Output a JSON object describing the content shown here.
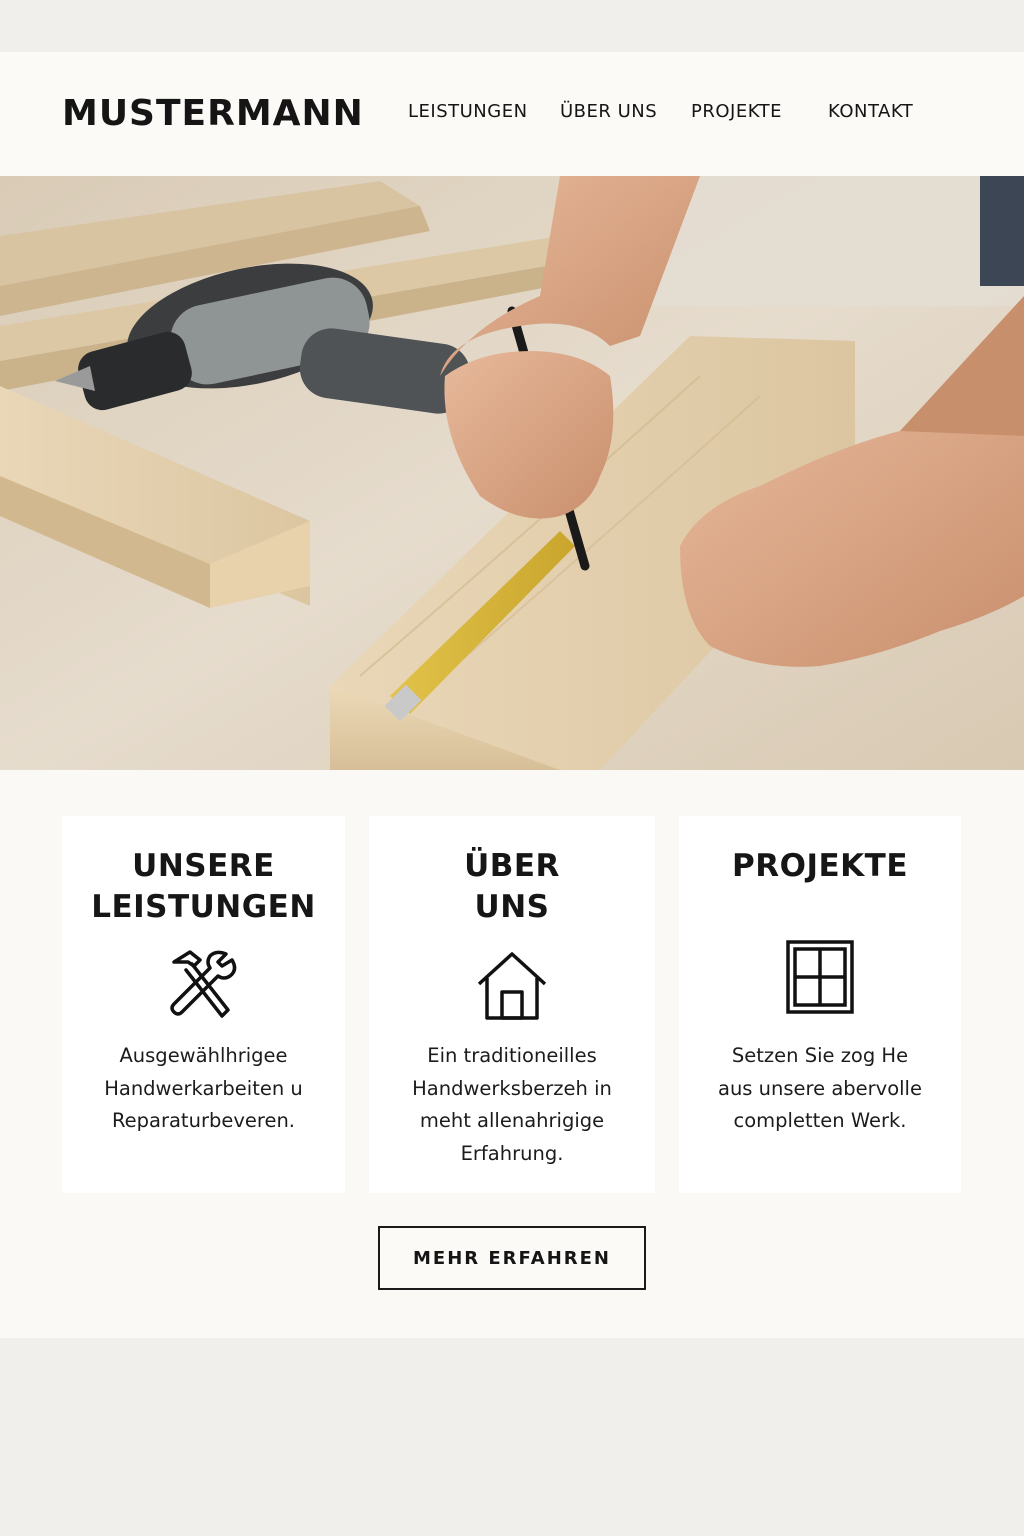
{
  "brand": {
    "logo_text": "MUSTERMANN"
  },
  "nav": {
    "items": [
      {
        "label": "LEISTUNGEN"
      },
      {
        "label": "ÜBER UNS"
      },
      {
        "label": "PROJEKTE"
      },
      {
        "label": "KONTAKT"
      }
    ]
  },
  "hero": {
    "image_subject": "hands marking wooden board with pencil and tape measure, cordless drill in background"
  },
  "cards": [
    {
      "title_line1": "UNSERE",
      "title_line2": "LEISTUNGEN",
      "icon": "hammer-wrench-icon",
      "text_lines": [
        "Ausgewählhrigee",
        "Handwerkarbeiten u",
        "Reparaturbeveren."
      ]
    },
    {
      "title_line1": "ÜBER",
      "title_line2": "UNS",
      "icon": "house-icon",
      "text_lines": [
        "Ein traditioneilles",
        "Handwerksberzeh in",
        "meht allenahrigige",
        "Erfahrung."
      ]
    },
    {
      "title_line1": "PROJEKTE",
      "title_line2": "",
      "icon": "window-icon",
      "text_lines": [
        "Setzen Sie zog He",
        "aus unsere abervolle",
        "completten Werk."
      ]
    }
  ],
  "cta": {
    "label": "MEHR ERFAHREN"
  },
  "colors": {
    "page_bg": "#f1efec",
    "panel_bg": "#faf9f6",
    "text": "#151515",
    "wood": "#e6d3b5"
  }
}
